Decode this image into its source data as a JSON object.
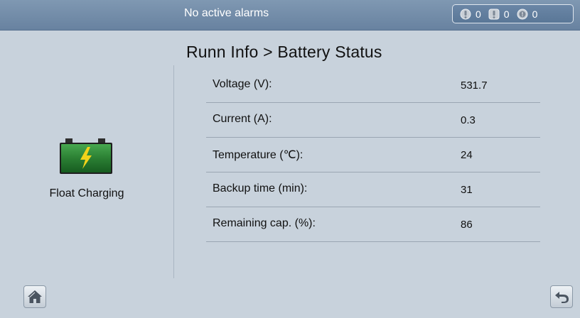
{
  "header": {
    "alarm_status": "No active alarms",
    "counters": [
      {
        "icon": "minor-alarm-icon",
        "count": "0"
      },
      {
        "icon": "major-alarm-icon",
        "count": "0"
      },
      {
        "icon": "critical-alarm-icon",
        "count": "0"
      }
    ]
  },
  "page": {
    "title": "Runn Info > Battery Status"
  },
  "battery": {
    "icon": "battery-charging-icon",
    "state": "Float Charging"
  },
  "rows": [
    {
      "label": "Voltage (V):",
      "value": "531.7"
    },
    {
      "label": "Current (A):",
      "value": "0.3"
    },
    {
      "label": "Temperature (℃):",
      "value": "24"
    },
    {
      "label": "Backup time (min):",
      "value": "31"
    },
    {
      "label": "Remaining cap. (%):",
      "value": "86"
    }
  ],
  "footer": {
    "home_icon": "home-icon",
    "back_icon": "back-arrow-icon"
  },
  "colors": {
    "header": "#7890ab",
    "background": "#c8d2dc",
    "battery_body": "#2f8a3a",
    "battery_bolt": "#f2d21a"
  }
}
